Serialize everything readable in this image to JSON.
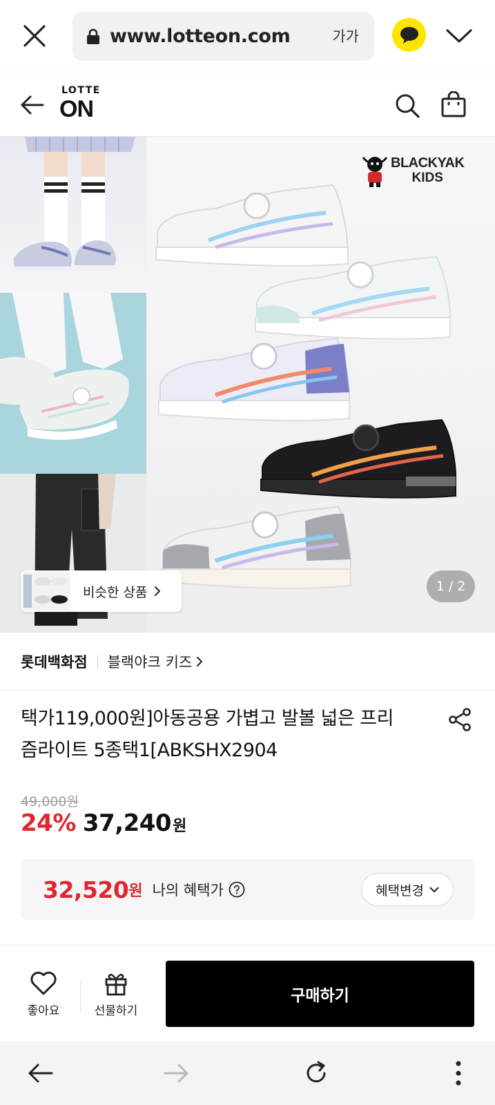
{
  "browser": {
    "url": "www.lotteon.com",
    "text_size_label": "가가",
    "kakao_color": "#fee500"
  },
  "header": {
    "logo_top": "LOTTE",
    "logo_bottom": "ON"
  },
  "hero": {
    "brand_line1": "BLACKYAK",
    "brand_line2": "KIDS",
    "similar_label": "비슷한 상품",
    "page_indicator": "1 / 2"
  },
  "seller": {
    "name": "롯데백화점",
    "brand_link": "블랙야크 키즈"
  },
  "product": {
    "title_line1": "택가119,000원]아동공용 가볍고 발볼 넓은 프리",
    "title_line2": "즘라이트 5종택1[ABKSHX2904",
    "original_price": "49,000원",
    "discount": "24%",
    "sale_price": "37,240",
    "sale_unit": "원",
    "benefit_price": "32,520",
    "benefit_unit": "원",
    "benefit_label": "나의 혜택가",
    "benefit_change_label": "혜택변경",
    "accent_color": "#e0262f"
  },
  "actions": {
    "like_label": "좋아요",
    "gift_label": "선물하기",
    "buy_label": "구매하기"
  }
}
